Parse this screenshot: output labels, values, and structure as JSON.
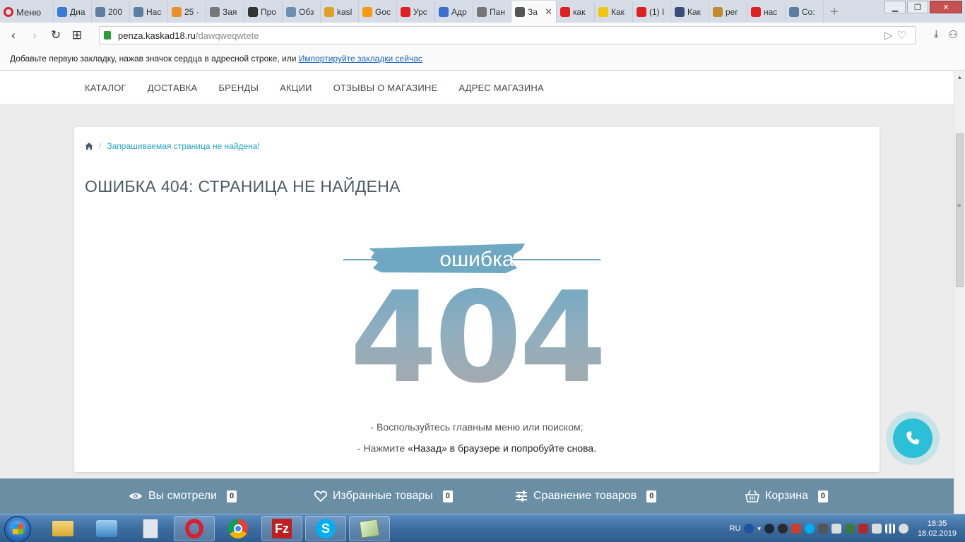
{
  "browser": {
    "menu_label": "Меню",
    "tabs": [
      {
        "label": "Диа",
        "icon": "chat-icon",
        "color": "#3b7bd4"
      },
      {
        "label": "200",
        "icon": "globe-icon",
        "color": "#5d7ea0"
      },
      {
        "label": "Нас",
        "icon": "globe-icon",
        "color": "#5d7ea0"
      },
      {
        "label": "25 ·",
        "icon": "mail-icon",
        "color": "#e8902a"
      },
      {
        "label": "Зая",
        "icon": "loading-icon",
        "color": "#777777"
      },
      {
        "label": "Про",
        "icon": "code-icon",
        "color": "#333333"
      },
      {
        "label": "Обз",
        "icon": "document-icon",
        "color": "#6a8fb0"
      },
      {
        "label": "kasl",
        "icon": "analytics-icon",
        "color": "#e0a025"
      },
      {
        "label": "Goc",
        "icon": "analytics-icon",
        "color": "#f29b0c"
      },
      {
        "label": "Урс",
        "icon": "youtube-icon",
        "color": "#e02020"
      },
      {
        "label": "Адр",
        "icon": "map-icon",
        "color": "#3b6fd0"
      },
      {
        "label": "Пан",
        "icon": "document-icon",
        "color": "#777777"
      },
      {
        "label": "За",
        "icon": "document-icon",
        "color": "#555555",
        "active": true
      },
      {
        "label": "как",
        "icon": "yandex-icon",
        "color": "#e02020"
      },
      {
        "label": "Как",
        "icon": "play-icon",
        "color": "#f2c40c"
      },
      {
        "label": "(1) I",
        "icon": "youtube-icon",
        "color": "#e02020"
      },
      {
        "label": "Как",
        "icon": "person-icon",
        "color": "#3a4d7a"
      },
      {
        "label": "рег",
        "icon": "ribbon-icon",
        "color": "#c28a2a"
      },
      {
        "label": "нас",
        "icon": "yandex-icon",
        "color": "#e02020"
      },
      {
        "label": "Со:",
        "icon": "globe-icon",
        "color": "#5d7ea0"
      }
    ],
    "url_host": "penza.kaskad18.ru",
    "url_path": "/dawqweqwtete",
    "bookmarks_text": "Добавьте первую закладку, нажав значок сердца в адресной строке, или",
    "bookmarks_link": "Импортируйте закладки сейчас"
  },
  "site": {
    "nav": [
      "КАТАЛОГ",
      "ДОСТАВКА",
      "БРЕНДЫ",
      "АКЦИИ",
      "ОТЗЫВЫ О МАГАЗИНЕ",
      "АДРЕС МАГАЗИНА"
    ],
    "breadcrumb": "Запрашиваемая страница не найдена!",
    "title": "ОШИБКА 404: СТРАНИЦА НЕ НАЙДЕНА",
    "error_word": "ошибка",
    "error_number": "404",
    "hint1": "- Воспользуйтесь главным меню или поиском;",
    "hint2_prefix": "- Нажмите ",
    "hint2_quote": "«Назад» в браузере и попробуйте снова.",
    "bottom_bar": [
      {
        "label": "Вы смотрели",
        "count": "0",
        "icon": "eye-icon"
      },
      {
        "label": "Избранные товары",
        "count": "0",
        "icon": "heart-icon"
      },
      {
        "label": "Сравнение товаров",
        "count": "0",
        "icon": "sliders-icon"
      },
      {
        "label": "Корзина",
        "count": "0",
        "icon": "basket-icon"
      }
    ],
    "accent": "#23a6c9",
    "bottom_bar_color": "#6a8fa5"
  },
  "taskbar": {
    "lang": "RU",
    "time": "18:35",
    "date": "18.02.2019"
  }
}
